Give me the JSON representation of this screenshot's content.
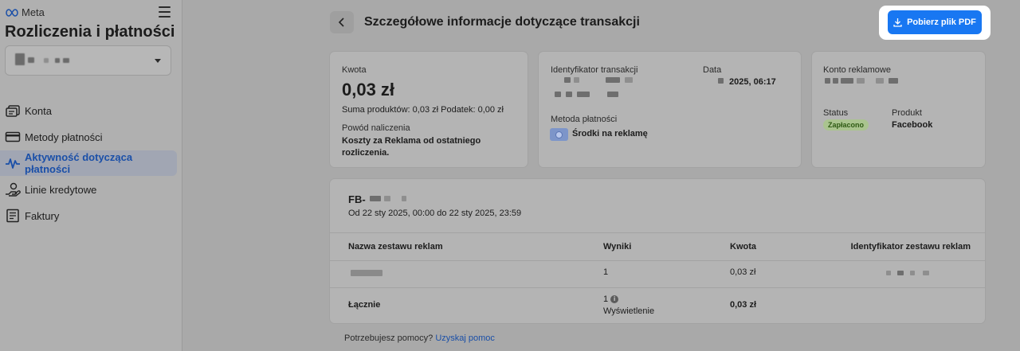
{
  "brand": {
    "logo_text": "Meta"
  },
  "sidebar": {
    "title": "Rozliczenia i płatności",
    "items": [
      {
        "label": "Konta",
        "icon": "accounts-icon"
      },
      {
        "label": "Metody płatności",
        "icon": "credit-card-icon"
      },
      {
        "label": "Aktywność dotycząca płatności",
        "icon": "activity-pulse-icon",
        "active": true
      },
      {
        "label": "Linie kredytowe",
        "icon": "hand-coins-icon"
      },
      {
        "label": "Faktury",
        "icon": "invoice-icon"
      }
    ]
  },
  "header": {
    "title": "Szczegółowe informacje dotyczące transakcji",
    "pdf_button": "Pobierz plik PDF"
  },
  "amount_card": {
    "label": "Kwota",
    "amount": "0,03 zł",
    "breakdown": "Suma produktów: 0,03 zł  Podatek: 0,00 zł",
    "reason_label": "Powód naliczenia",
    "reason_line1": "Koszty za Reklama od ostatniego",
    "reason_line2": "rozliczenia."
  },
  "transaction_card": {
    "id_label": "Identyfikator transakcji",
    "date_label": "Data",
    "date_value": "2025, 06:17",
    "method_label": "Metoda płatności",
    "method_value": "Środki na reklamę"
  },
  "account_card": {
    "label": "Konto reklamowe",
    "status_label": "Status",
    "status_value": "Zapłacono",
    "product_label": "Produkt",
    "product_value": "Facebook"
  },
  "campaign": {
    "id_prefix": "FB-",
    "period": "Od 22 sty 2025, 00:00 do 22 sty 2025, 23:59",
    "columns": [
      "Nazwa zestawu reklam",
      "Wyniki",
      "Kwota",
      "Identyfikator zestawu reklam"
    ],
    "rows": [
      {
        "results": "1",
        "amount": "0,03 zł"
      }
    ],
    "total": {
      "label": "Łącznie",
      "results": "1",
      "results_unit": "Wyświetlenie",
      "amount": "0,03 zł"
    }
  },
  "footer": {
    "help_text": "Potrzebujesz pomocy?",
    "help_link": "Uzyskaj pomoc"
  },
  "colors": {
    "accent": "#1877f2",
    "active_nav": "#1a4fa8",
    "status_paid_bg": "#aac48f"
  }
}
